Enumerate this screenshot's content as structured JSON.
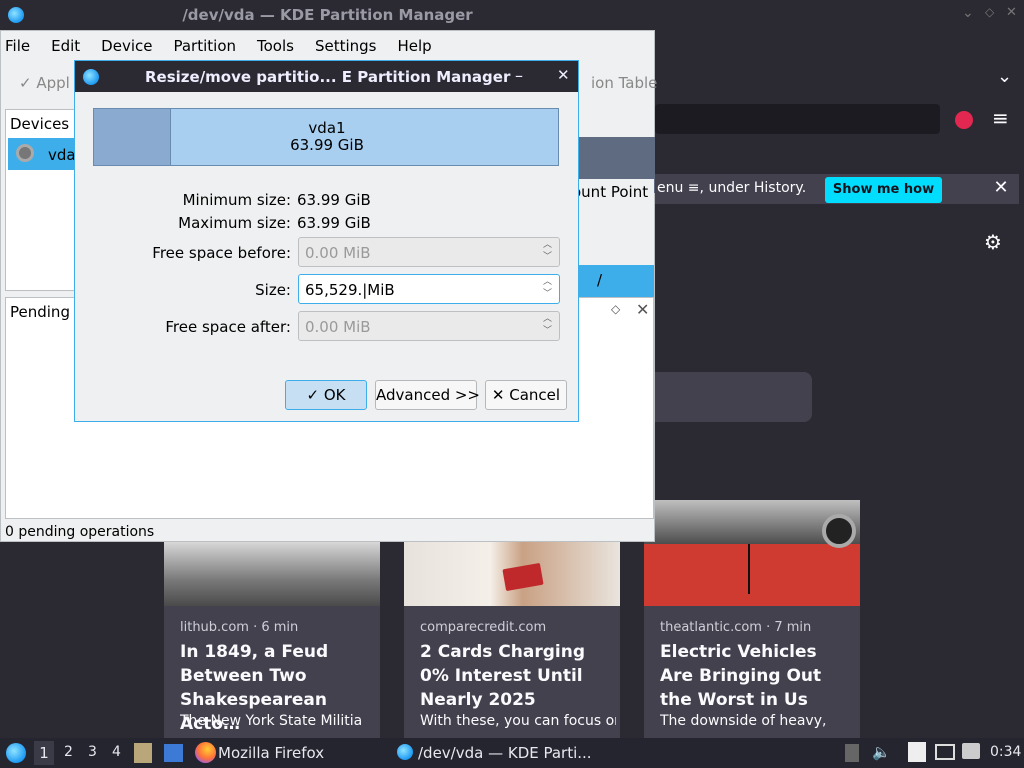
{
  "firefox": {
    "notification_text": "enu ≡, under History.",
    "show_me_how": "Show me how",
    "close_glyph": "✕",
    "gear_glyph": "⚙",
    "chevron_glyph": "⌄",
    "menu_glyph": "≡",
    "cards": [
      {
        "source": "lithub.com · 6 min",
        "title": "In 1849, a Feud Between Two Shakespearean Acto…",
        "desc": "The New York State Militia"
      },
      {
        "source": "comparecredit.com",
        "title": "2 Cards Charging 0% Interest Until Nearly 2025",
        "desc": "With these, you can focus on"
      },
      {
        "source": "theatlantic.com · 7 min",
        "title": "Electric Vehicles Are Bringing Out the Worst in Us",
        "desc": "The downside of heavy,"
      }
    ]
  },
  "kpm": {
    "title": "/dev/vda — KDE Partition Manager",
    "menu": [
      "File",
      "Edit",
      "Device",
      "Partition",
      "Tools",
      "Settings",
      "Help"
    ],
    "toolbar_apply": "✓ Appl",
    "toolbar_right": "ion Table",
    "devices_label": "Devices",
    "device_name": "vda",
    "mount_point_header": "ount Point",
    "mount_point_value": "/",
    "pending_label": "Pending O",
    "pending_float": "◇",
    "pending_close": "✕",
    "status": "0 pending operations"
  },
  "dialog": {
    "title": "Resize/move partitio...  E Partition Manager",
    "minimize": "–",
    "close": "✕",
    "partition_name": "vda1",
    "partition_size": "63.99 GiB",
    "min_size_label": "Minimum size:",
    "min_size_value": "63.99 GiB",
    "max_size_label": "Maximum size:",
    "max_size_value": "63.99 GiB",
    "free_before_label": "Free space before:",
    "free_before_value": "0.00 MiB",
    "size_label": "Size:",
    "size_value": "65,529.|MiB",
    "free_after_label": "Free space after:",
    "free_after_value": "0.00 MiB",
    "ok_label": "✓  OK",
    "advanced_label": "Advanced >>",
    "cancel_label": "✕  Cancel"
  },
  "taskbar": {
    "desktops": [
      "1",
      "2",
      "3",
      "4"
    ],
    "firefox_label": "Mozilla Firefox",
    "kpm_label": "/dev/vda — KDE Parti...",
    "clock": "0:34"
  }
}
